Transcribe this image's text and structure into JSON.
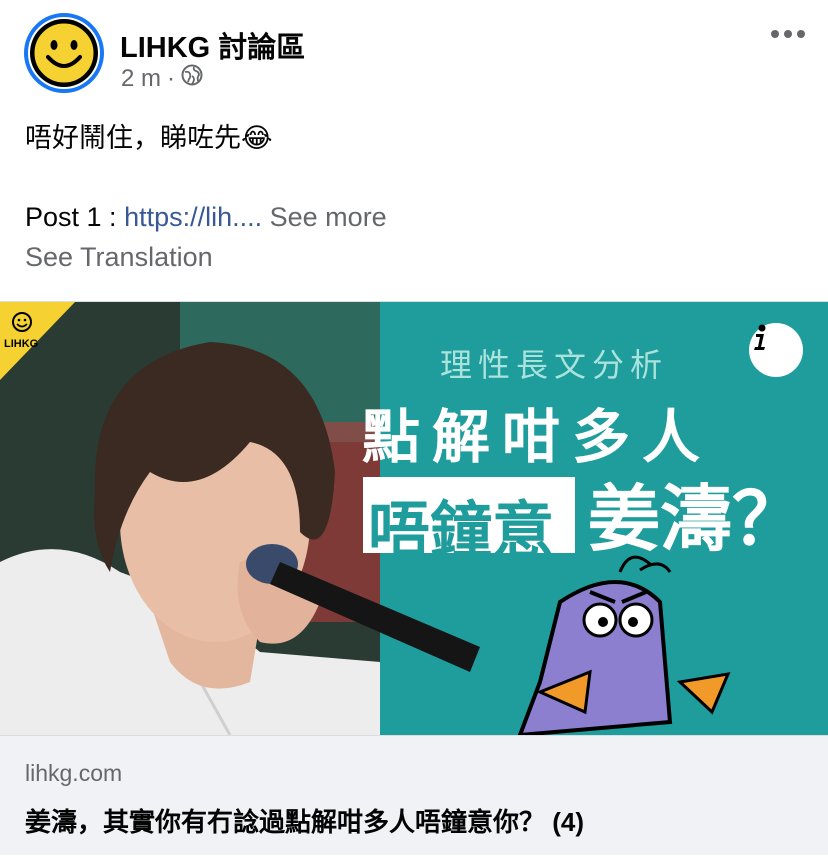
{
  "post": {
    "page_name": "LIHKG 討論區",
    "time": "2 m",
    "separator": "·",
    "text": "唔好鬧住，睇咗先😂",
    "line2_prefix": "Post 1 : ",
    "line2_link": "https://lih....",
    "see_more": "See more",
    "see_translation": "See Translation"
  },
  "icons": {
    "avatar": "smiley-logo-icon",
    "audience": "globe-icon",
    "more": "more-dots-icon",
    "info": "info-icon"
  },
  "preview": {
    "logo_label": "LIHKG",
    "overlay_small": "理性長文分析",
    "overlay_line1": "點解咁多人",
    "overlay_highlight": "唔鐘意",
    "overlay_name": "姜濤？"
  },
  "link_card": {
    "domain": "lihkg.com",
    "title": "姜濤，其實你有冇諗過點解咁多人唔鐘意你？ (4)"
  },
  "colors": {
    "brand_blue": "#1877f2",
    "teal": "#1f9c9c",
    "yellow": "#f5d232",
    "secondary_text": "#65676b",
    "link": "#385898"
  }
}
